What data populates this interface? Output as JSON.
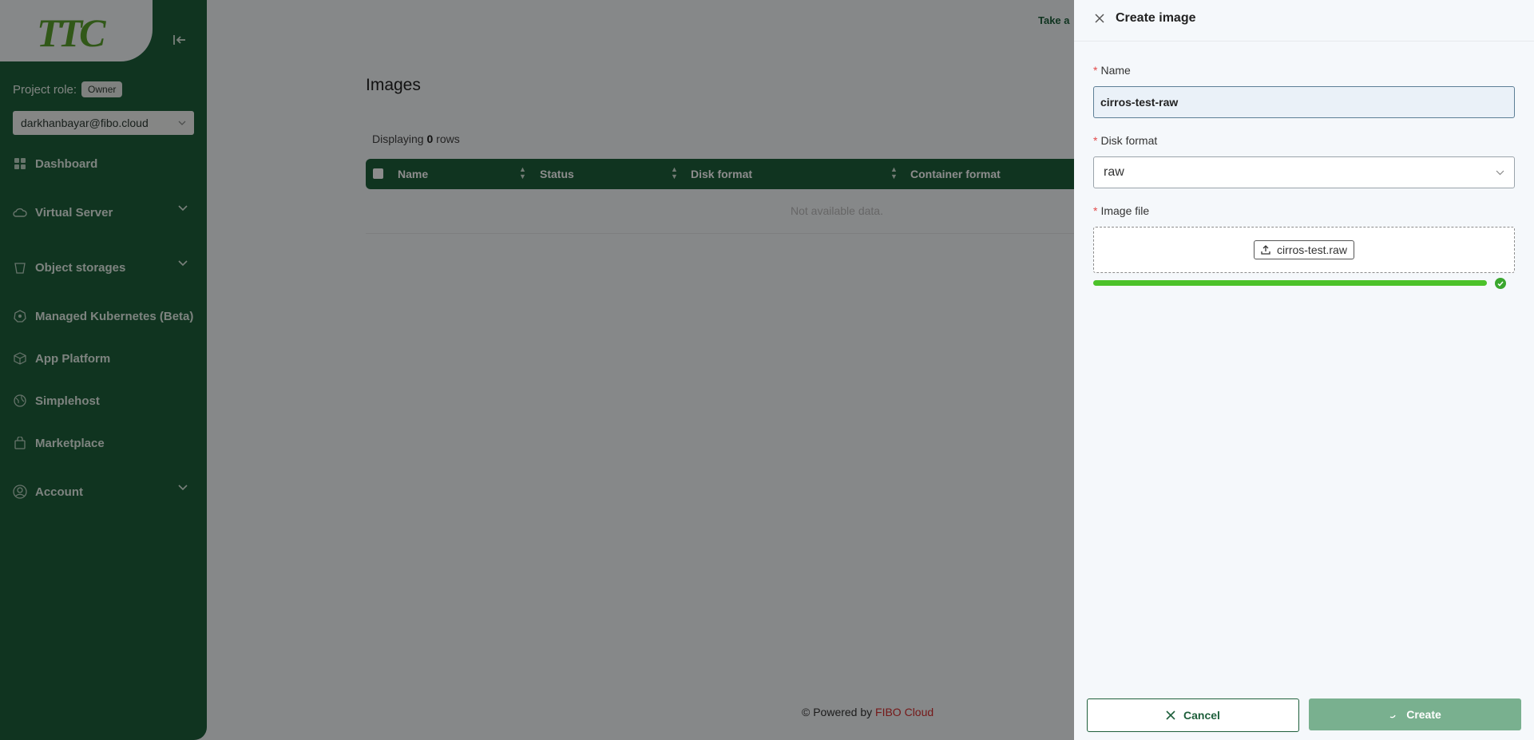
{
  "sidebar": {
    "logo_text": "TTC",
    "project_role_label": "Project role:",
    "project_role_value": "Owner",
    "user_email": "darkhanbayar@fibo.cloud",
    "items": [
      {
        "label": "Dashboard",
        "icon": "grid-icon"
      },
      {
        "label": "Virtual Server",
        "icon": "cloud-icon",
        "expandable": true
      },
      {
        "label": "Object storages",
        "icon": "bucket-icon",
        "expandable": true
      },
      {
        "label": "Managed Kubernetes (Beta)",
        "icon": "kubernetes-icon"
      },
      {
        "label": "App Platform",
        "icon": "cube-icon"
      },
      {
        "label": "Simplehost",
        "icon": "globe-icon"
      },
      {
        "label": "Marketplace",
        "icon": "bag-icon"
      },
      {
        "label": "Account",
        "icon": "user-circle-icon",
        "expandable": true
      }
    ]
  },
  "main": {
    "title": "Images",
    "rows_prefix": "Displaying",
    "rows_count": "0",
    "rows_suffix": "rows",
    "columns": [
      "Name",
      "Status",
      "Disk format",
      "Container format"
    ],
    "empty_text": "Not available data.",
    "top_link": "Take a",
    "footer_prefix": "© Powered by",
    "footer_brand": "FIBO Cloud"
  },
  "drawer": {
    "title": "Create image",
    "name_label": "Name",
    "name_value": "cirros-test-raw",
    "disk_format_label": "Disk format",
    "disk_format_value": "raw",
    "image_file_label": "Image file",
    "file_name": "cirros-test.raw",
    "upload_progress_percent": 100,
    "cancel_label": "Cancel",
    "create_label": "Create"
  },
  "colors": {
    "brand_green": "#1e5f3b",
    "progress_green": "#4cc22a",
    "required_red": "#e34b4b",
    "footer_brand_red": "#d62e2e"
  }
}
